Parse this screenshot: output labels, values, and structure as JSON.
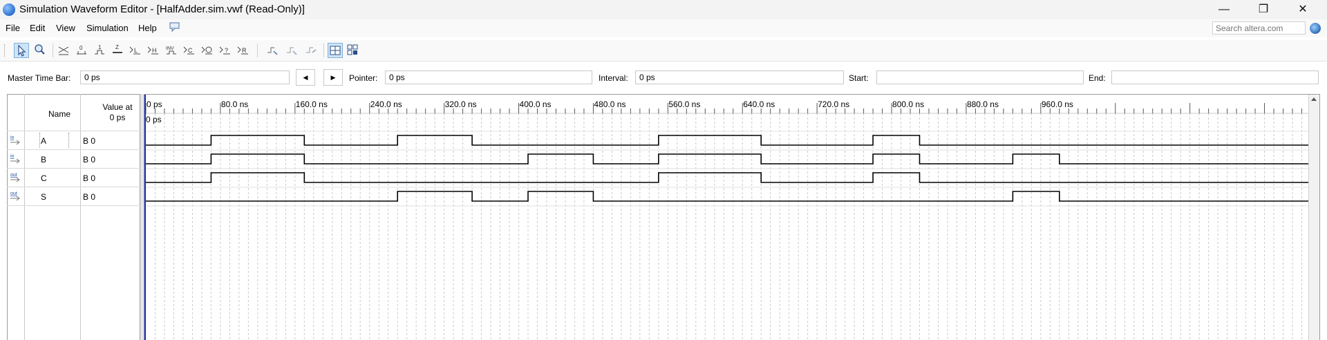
{
  "window": {
    "title": "Simulation Waveform Editor - [HalfAdder.sim.vwf (Read-Only)]",
    "minimize": "—",
    "restore": "❐",
    "close": "✕"
  },
  "menu": {
    "items": [
      "File",
      "Edit",
      "View",
      "Simulation",
      "Help"
    ],
    "search_placeholder": "Search altera.com"
  },
  "toolbar": {
    "tools": [
      {
        "icon": "selection-tool-icon"
      },
      {
        "icon": "zoom-tool-icon"
      },
      {
        "icon": "forcing-unknown-icon",
        "glyph": "X"
      },
      {
        "icon": "forcing-low-icon",
        "glyph": "0"
      },
      {
        "icon": "forcing-high-icon",
        "glyph": "1"
      },
      {
        "icon": "high-impedance-icon",
        "glyph": "Z"
      },
      {
        "icon": "weak-low-icon",
        "glyph": "L"
      },
      {
        "icon": "weak-high-icon",
        "glyph": "H"
      },
      {
        "icon": "invert-icon",
        "glyph": "INV"
      },
      {
        "icon": "count-value-icon",
        "glyph": "C"
      },
      {
        "icon": "clock-icon",
        "glyph": "C"
      },
      {
        "icon": "arbitrary-value-icon",
        "glyph": "?"
      },
      {
        "icon": "random-value-icon",
        "glyph": "R"
      },
      {
        "icon": "snap-to-grid-icon"
      },
      {
        "icon": "grid-settings-icon"
      },
      {
        "icon": "waveform-settings-icon"
      },
      {
        "icon": "show-grid-icon"
      },
      {
        "icon": "snap-settings-icon"
      }
    ]
  },
  "timebar": {
    "master_label": "Master Time Bar:",
    "master_value": "0 ps",
    "pointer_label": "Pointer:",
    "pointer_value": "0 ps",
    "interval_label": "Interval:",
    "interval_value": "0 ps",
    "start_label": "Start:",
    "start_value": "",
    "end_label": "End:",
    "end_value": ""
  },
  "grid_header": {
    "name": "Name",
    "value_at": "Value at",
    "value_time": "0 ps",
    "marker": "0 ps"
  },
  "time_axis": {
    "unit": "ns",
    "max_ns": 1000,
    "tick_labels": [
      "0 ps",
      "80.0 ns",
      "160.0 ns",
      "240.0 ns",
      "320.0 ns",
      "400.0 ns",
      "480.0 ns",
      "560.0 ns",
      "640.0 ns",
      "720.0 ns",
      "800.0 ns",
      "880.0 ns",
      "960.0 ns"
    ],
    "tick_values_ns": [
      0,
      80,
      160,
      240,
      320,
      400,
      480,
      560,
      640,
      720,
      800,
      880,
      960
    ]
  },
  "signals": [
    {
      "direction": "in",
      "name": "A",
      "value": "B 0",
      "transitions_ns": [
        [
          0,
          0
        ],
        [
          70,
          1
        ],
        [
          170,
          0
        ],
        [
          270,
          1
        ],
        [
          350,
          0
        ],
        [
          550,
          1
        ],
        [
          660,
          0
        ],
        [
          780,
          1
        ],
        [
          830,
          0
        ]
      ]
    },
    {
      "direction": "in",
      "name": "B",
      "value": "B 0",
      "transitions_ns": [
        [
          0,
          0
        ],
        [
          70,
          1
        ],
        [
          170,
          0
        ],
        [
          410,
          1
        ],
        [
          480,
          0
        ],
        [
          550,
          1
        ],
        [
          660,
          0
        ],
        [
          780,
          1
        ],
        [
          830,
          0
        ],
        [
          930,
          1
        ],
        [
          980,
          0
        ]
      ]
    },
    {
      "direction": "out",
      "name": "C",
      "value": "B 0",
      "transitions_ns": [
        [
          0,
          0
        ],
        [
          70,
          1
        ],
        [
          170,
          0
        ],
        [
          550,
          1
        ],
        [
          660,
          0
        ],
        [
          780,
          1
        ],
        [
          830,
          0
        ]
      ]
    },
    {
      "direction": "out",
      "name": "S",
      "value": "B 0",
      "transitions_ns": [
        [
          0,
          0
        ],
        [
          270,
          1
        ],
        [
          350,
          0
        ],
        [
          410,
          1
        ],
        [
          480,
          0
        ],
        [
          930,
          1
        ],
        [
          980,
          0
        ]
      ]
    }
  ],
  "colors": {
    "cursor": "#1a33c8",
    "grid_dash": "#c9c9c9",
    "wave": "#000000"
  }
}
